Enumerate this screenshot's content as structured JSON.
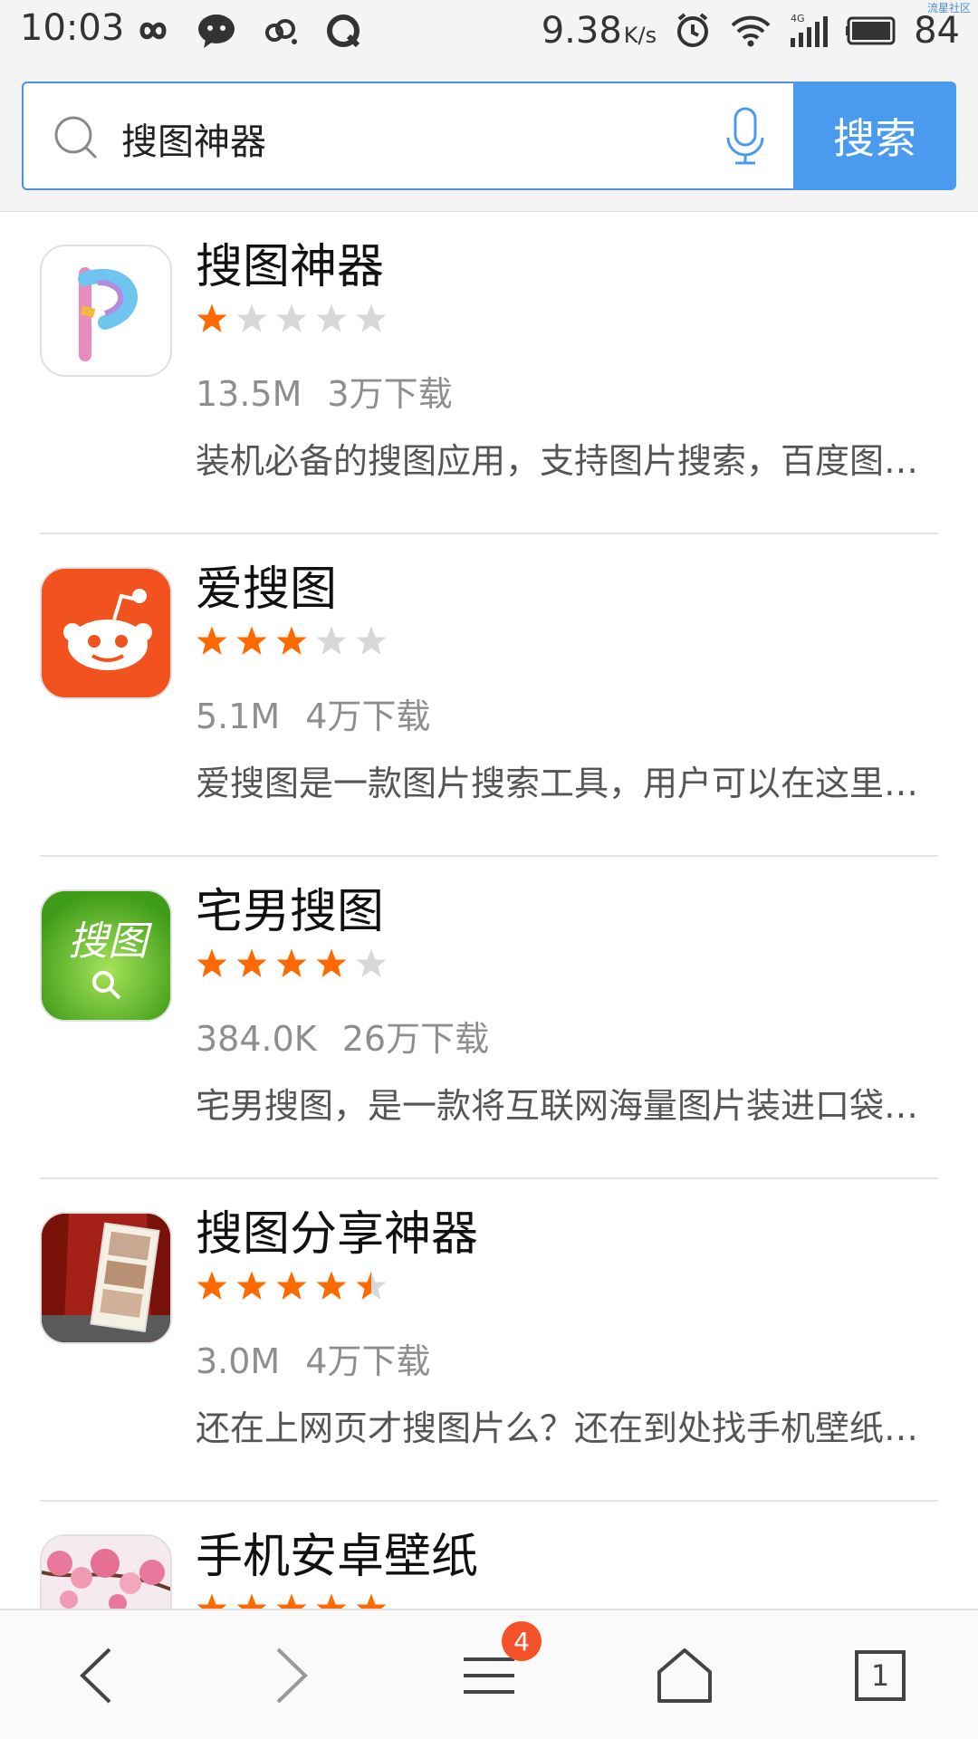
{
  "status_bar": {
    "time": "10:03",
    "speed_value": "9.38",
    "speed_unit": "K/s",
    "battery": "84",
    "watermark": "流星社区",
    "icons": [
      "infinity-icon",
      "chat-bubble-icon",
      "cloud-sync-icon",
      "circle-q-icon",
      "alarm-icon",
      "wifi-icon",
      "signal-4g-icon",
      "battery-icon"
    ]
  },
  "search": {
    "query": "搜图神器",
    "button_label": "搜索",
    "accent": "#4a9bf0"
  },
  "apps": [
    {
      "name": "搜图神器",
      "rating": 1,
      "size": "13.5M",
      "downloads": "3万下载",
      "description": "装机必备的搜图应用，支持图片搜索，百度图片、搜狗图片等",
      "icon": "pastel-p-logo-icon"
    },
    {
      "name": "爱搜图",
      "rating": 3,
      "size": "5.1M",
      "downloads": "4万下载",
      "description": "爱搜图是一款图片搜索工具，用户可以在这里找到想要的图片",
      "icon": "alien-face-logo-icon"
    },
    {
      "name": "宅男搜图",
      "rating": 4,
      "size": "384.0K",
      "downloads": "26万下载",
      "description": "宅男搜图，是一款将互联网海量图片装进口袋的应用程序",
      "icon": "green-sotu-logo-icon"
    },
    {
      "name": "搜图分享神器",
      "rating": 4.5,
      "size": "3.0M",
      "downloads": "4万下载",
      "description": "还在上网页才搜图片么？还在到处找手机壁纸吗？快来试试",
      "icon": "photo-curtain-logo-icon"
    },
    {
      "name": "手机安卓壁纸",
      "rating": 5,
      "size": "",
      "downloads": "",
      "description": "",
      "icon": "cherry-blossom-logo-icon"
    }
  ],
  "bottom_nav": {
    "badge": "4",
    "tab_count": "1"
  },
  "colors": {
    "star_on": "#ff6a00",
    "star_off": "#d8d8d8"
  }
}
